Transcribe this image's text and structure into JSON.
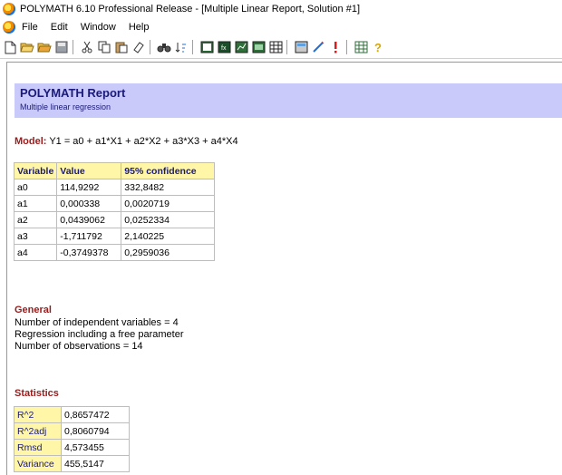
{
  "window": {
    "title": "POLYMATH 6.10 Professional Release - [Multiple Linear Report, Solution #1]"
  },
  "menu": {
    "items": [
      "File",
      "Edit",
      "Window",
      "Help"
    ]
  },
  "toolbar": {
    "buttons": [
      "new-file-icon",
      "open-icon",
      "open-alt-icon",
      "save-icon",
      "cut-icon",
      "copy-icon",
      "paste-icon",
      "eraser-icon",
      "find-icon",
      "sort-icon",
      "data-table-icon",
      "chart-icon",
      "graph-icon",
      "report-icon",
      "calculator-icon",
      "wand-icon",
      "exclamation-icon",
      "grid-icon",
      "help-icon"
    ]
  },
  "report": {
    "title": "POLYMATH Report",
    "subtitle": "Multiple linear regression",
    "model_label": "Model:",
    "model_equation": "Y1 = a0 + a1*X1 + a2*X2 + a3*X3 + a4*X4",
    "params_headers": [
      "Variable",
      "Value",
      "95% confidence"
    ],
    "params": [
      [
        "a0",
        "114,9292",
        "332,8482"
      ],
      [
        "a1",
        "0,000338",
        "0,0020719"
      ],
      [
        "a2",
        "0,0439062",
        "0,0252334"
      ],
      [
        "a3",
        "-1,711792",
        "2,140225"
      ],
      [
        "a4",
        "-0,3749378",
        "0,2959036"
      ]
    ],
    "general_title": "General",
    "general_lines": [
      "Number of independent variables = 4",
      "Regression including a free parameter",
      "Number of observations = 14"
    ],
    "statistics_title": "Statistics",
    "statistics": [
      [
        "R^2",
        "0,8657472"
      ],
      [
        "R^2adj",
        "0,8060794"
      ],
      [
        "Rmsd",
        "4,573455"
      ],
      [
        "Variance",
        "455,5147"
      ]
    ]
  }
}
